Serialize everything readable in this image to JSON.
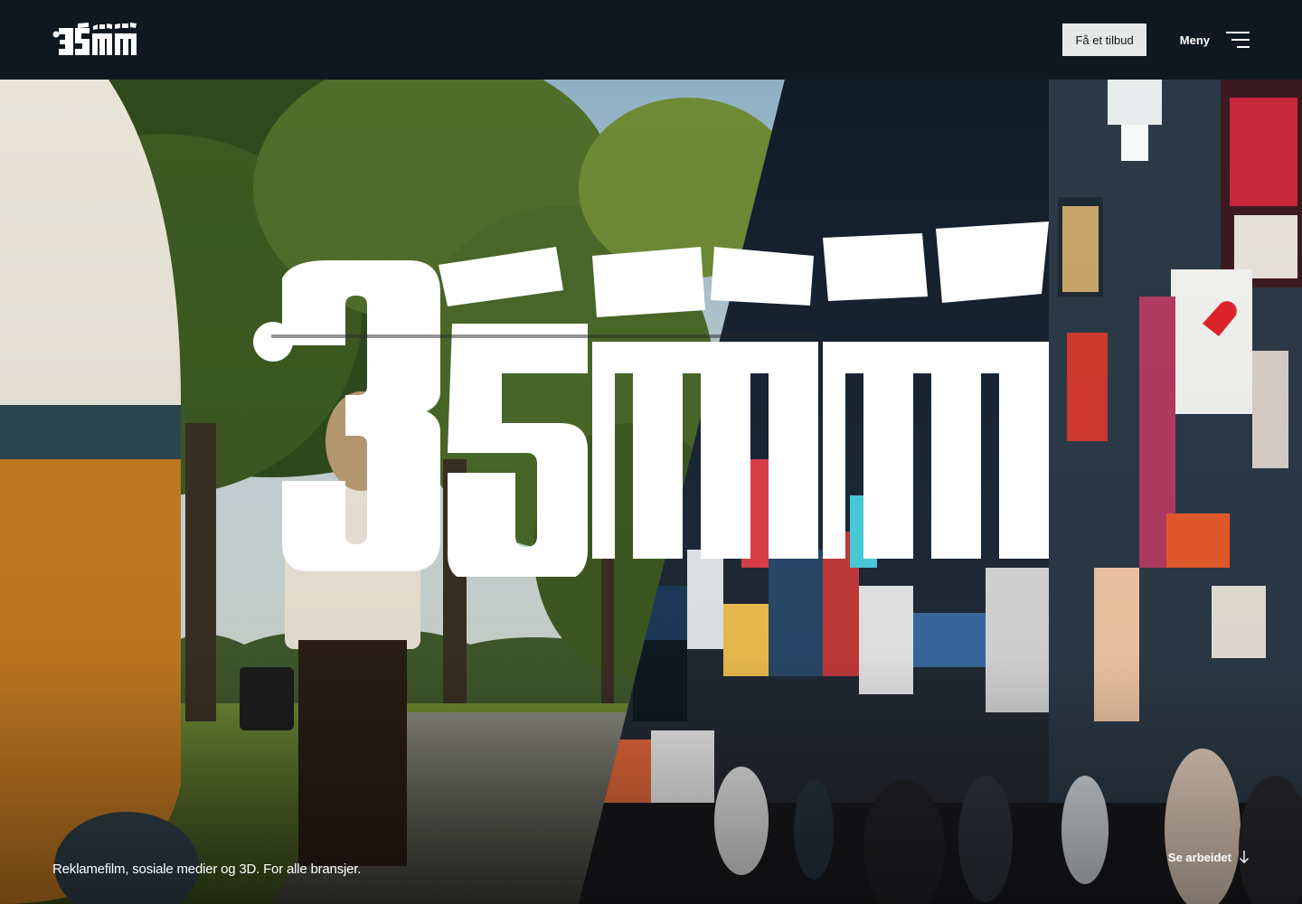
{
  "header": {
    "logo_text": "35MM",
    "cta_label": "Få et tilbud",
    "menu_label": "Meny"
  },
  "hero": {
    "logo_text": "35MM",
    "tagline": "Reklamefilm, sosiale medier og 3D. For alle bransjer.",
    "see_work_label": "Se arbeidet"
  },
  "colors": {
    "header_bg": "#0f1820",
    "cta_bg": "#e6e9e7",
    "text": "#ffffff"
  },
  "icons": {
    "menu": "hamburger-icon",
    "see_work": "arrow-down-icon"
  }
}
